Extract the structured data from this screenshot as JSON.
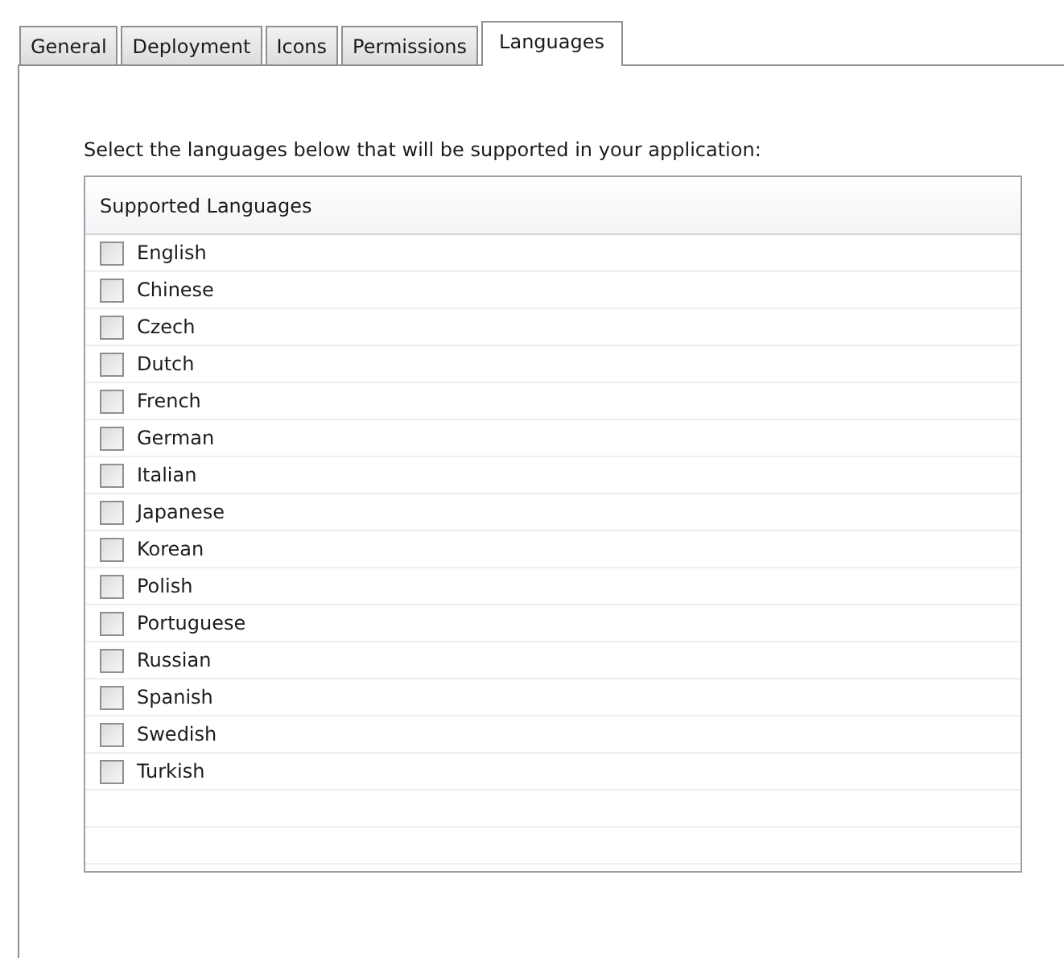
{
  "tabs": [
    {
      "label": "General",
      "selected": false
    },
    {
      "label": "Deployment",
      "selected": false
    },
    {
      "label": "Icons",
      "selected": false
    },
    {
      "label": "Permissions",
      "selected": false
    },
    {
      "label": "Languages",
      "selected": true
    }
  ],
  "instruction": "Select the languages below that will be supported in your application:",
  "list": {
    "header": "Supported Languages",
    "items": [
      {
        "label": "English",
        "checked": false
      },
      {
        "label": "Chinese",
        "checked": false
      },
      {
        "label": "Czech",
        "checked": false
      },
      {
        "label": "Dutch",
        "checked": false
      },
      {
        "label": "French",
        "checked": false
      },
      {
        "label": "German",
        "checked": false
      },
      {
        "label": "Italian",
        "checked": false
      },
      {
        "label": "Japanese",
        "checked": false
      },
      {
        "label": "Korean",
        "checked": false
      },
      {
        "label": "Polish",
        "checked": false
      },
      {
        "label": "Portuguese",
        "checked": false
      },
      {
        "label": "Russian",
        "checked": false
      },
      {
        "label": "Spanish",
        "checked": false
      },
      {
        "label": "Swedish",
        "checked": false
      },
      {
        "label": "Turkish",
        "checked": false
      }
    ]
  }
}
